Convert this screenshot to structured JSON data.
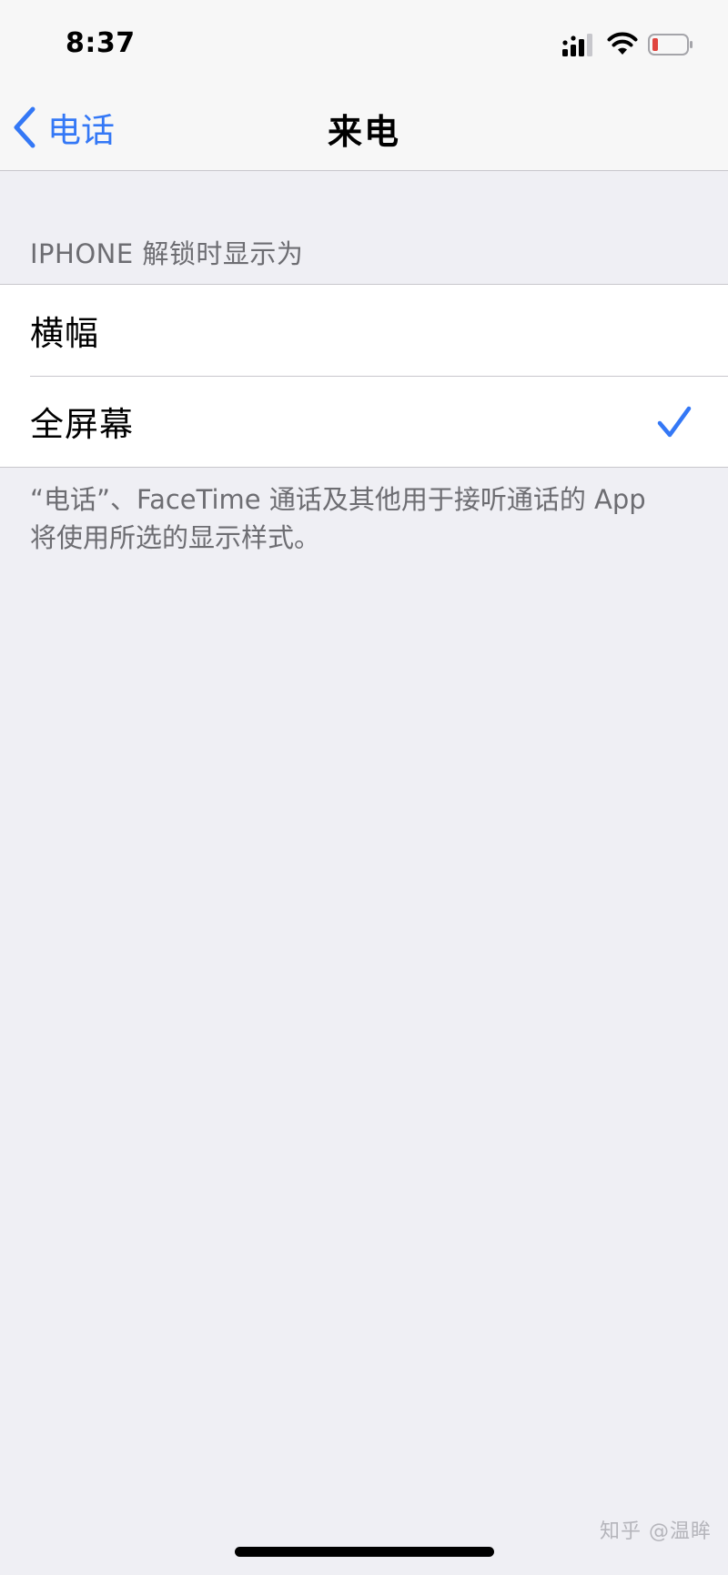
{
  "status_bar": {
    "time": "8:37",
    "icons": [
      "signal-icon",
      "wifi-icon",
      "battery-icon"
    ],
    "battery_color": "#e0443e"
  },
  "nav": {
    "back_label": "电话",
    "title": "来电",
    "accent_color": "#3478f6"
  },
  "section": {
    "header": "IPHONE 解锁时显示为",
    "options": [
      {
        "label": "横幅",
        "selected": false
      },
      {
        "label": "全屏幕",
        "selected": true
      }
    ],
    "footer_line1": "“电话”、FaceTime 通话及其他用于接听通话的 App",
    "footer_line2": "将使用所选的显示样式。"
  },
  "watermark": "知乎 @温眸"
}
